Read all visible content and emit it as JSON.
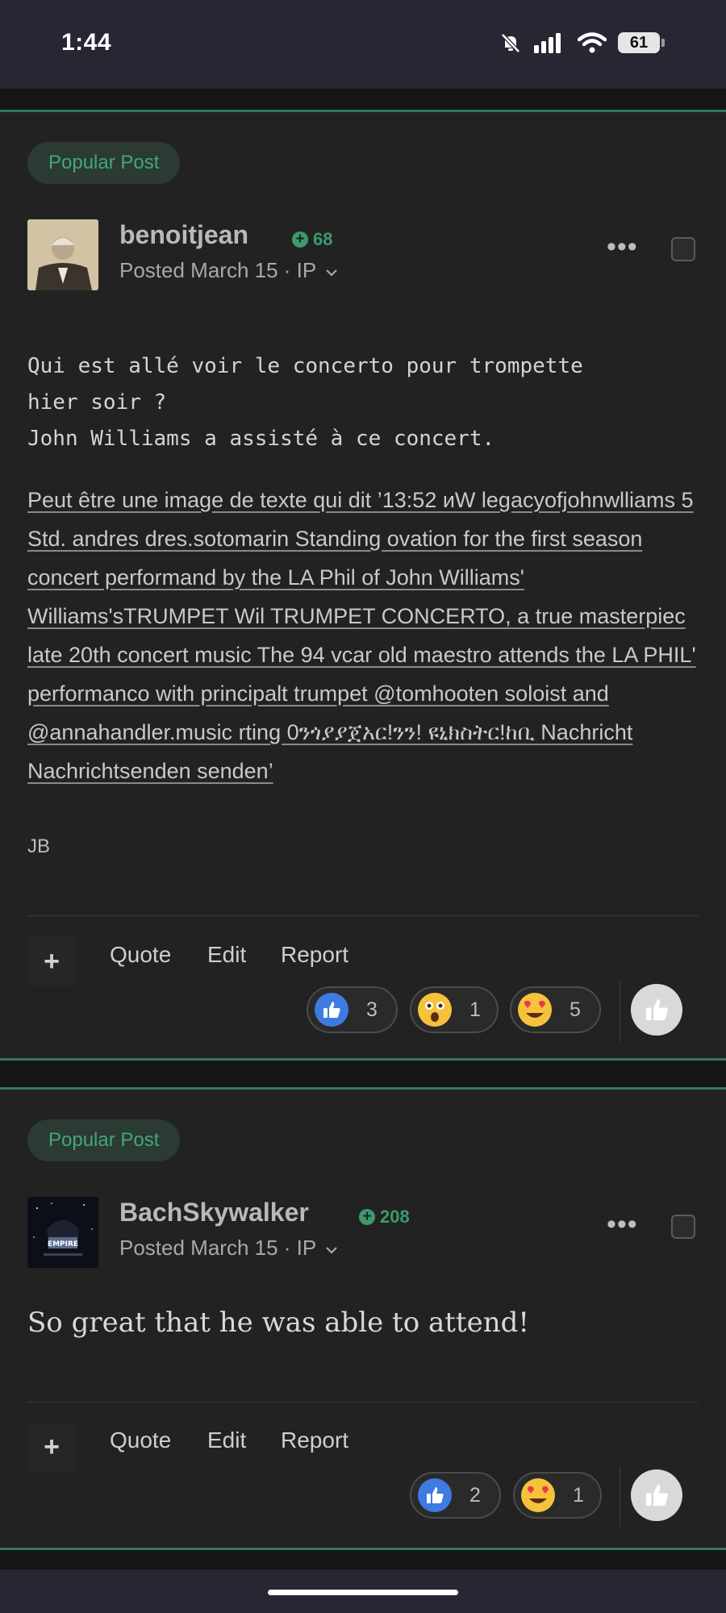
{
  "status_bar": {
    "time": "1:44",
    "battery": "61"
  },
  "posts": [
    {
      "badge": "Popular Post",
      "author": "benoitjean",
      "reputation": "68",
      "posted": "Posted March 15 · IP",
      "body_lines": [
        "Qui est allé voir le concerto pour trompette",
        "hier soir ?",
        "John Williams a assisté à ce concert."
      ],
      "image_alt": "Peut être une image de texte qui dit ’13:52 иW legacyofjohnwlliams 5 Std. andres dres.sotomarin Standing ovation for the first season concert performand by the LA Phil of John Williams' Williams'sTRUMPET Wil TRUMPET CONCERTO, a true masterpiec late 20th concert music The 94 vcar old maestro attends the LA PHIL' performanco with principalt trumpet @tomhooten soloist and @annahandler.music rting 0ንጎያያጀአር!ንን! ዩኒክስትር!ከቢ Nachricht Nachrichtsenden senden’",
      "signature": "JB",
      "actions": {
        "quote": "Quote",
        "edit": "Edit",
        "report": "Report"
      },
      "reactions": [
        {
          "icon": "thumbs-up-icon",
          "count": "3"
        },
        {
          "icon": "astonished-face-icon",
          "count": "1"
        },
        {
          "icon": "heart-eyes-icon",
          "count": "5"
        }
      ]
    },
    {
      "badge": "Popular Post",
      "author": "BachSkywalker",
      "reputation": "208",
      "posted": "Posted March 15 · IP",
      "body": "So great that he was able to attend!",
      "actions": {
        "quote": "Quote",
        "edit": "Edit",
        "report": "Report"
      },
      "reactions": [
        {
          "icon": "thumbs-up-icon",
          "count": "2"
        },
        {
          "icon": "heart-eyes-icon",
          "count": "1"
        }
      ]
    }
  ],
  "colors": {
    "accent_green": "#3c9a6d",
    "like_blue": "#3d7be0",
    "post_bg": "#222222"
  }
}
